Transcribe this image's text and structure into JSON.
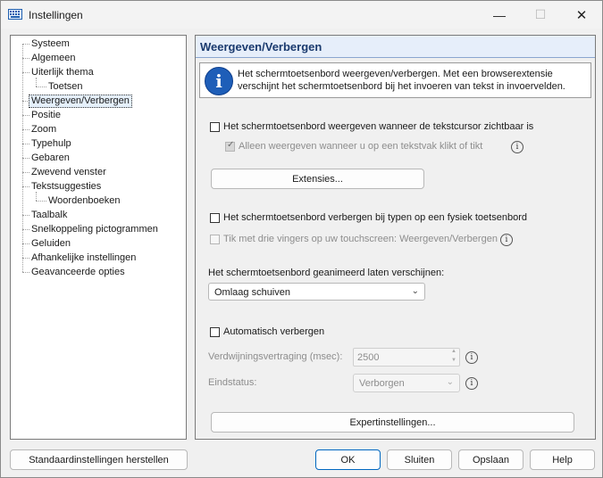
{
  "window": {
    "title": "Instellingen",
    "minimize": "—",
    "maximize": "☐",
    "close": "✕"
  },
  "tree": {
    "items": [
      {
        "label": "Systeem"
      },
      {
        "label": "Algemeen"
      },
      {
        "label": "Uiterlijk thema"
      },
      {
        "label": "Toetsen"
      },
      {
        "label": "Weergeven/Verbergen",
        "selected": true
      },
      {
        "label": "Positie"
      },
      {
        "label": "Zoom"
      },
      {
        "label": "Typehulp"
      },
      {
        "label": "Gebaren"
      },
      {
        "label": "Zwevend venster"
      },
      {
        "label": "Tekstsuggesties"
      },
      {
        "label": "Woordenboeken"
      },
      {
        "label": "Taalbalk"
      },
      {
        "label": "Snelkoppeling pictogrammen"
      },
      {
        "label": "Geluiden"
      },
      {
        "label": "Afhankelijke instellingen"
      },
      {
        "label": "Geavanceerde opties"
      }
    ]
  },
  "panel": {
    "title": "Weergeven/Verbergen",
    "info_text": "Het schermtoetsenbord weergeven/verbergen. Met een browserextensie verschijnt het schermtoetsenbord bij het invoeren van tekst in invoervelden.",
    "show_when_cursor": "Het schermtoetsenbord weergeven wanneer de tekstcursor zichtbaar is",
    "only_when_clicked": "Alleen weergeven wanneer u op een tekstvak klikt of tikt",
    "extensions_button": "Extensies...",
    "hide_when_typing": "Het schermtoetsenbord verbergen bij typen op een fysiek toetsenbord",
    "three_finger_tap": "Tik met drie vingers op uw touchscreen: Weergeven/Verbergen",
    "animation_label": "Het schermtoetsenbord geanimeerd laten verschijnen:",
    "animation_value": "Omlaag schuiven",
    "auto_hide": "Automatisch verbergen",
    "delay_label": "Verdwijningsvertraging (msec):",
    "delay_value": "2500",
    "end_state_label": "Eindstatus:",
    "end_state_value": "Verborgen",
    "expert_button": "Expertinstellingen..."
  },
  "footer": {
    "restore_defaults": "Standaardinstellingen herstellen",
    "ok": "OK",
    "close": "Sluiten",
    "save": "Opslaan",
    "help": "Help"
  },
  "icons": {
    "info": "i",
    "help": "i",
    "chevron": "⌄",
    "spin_up": "▲",
    "spin_down": "▼"
  }
}
